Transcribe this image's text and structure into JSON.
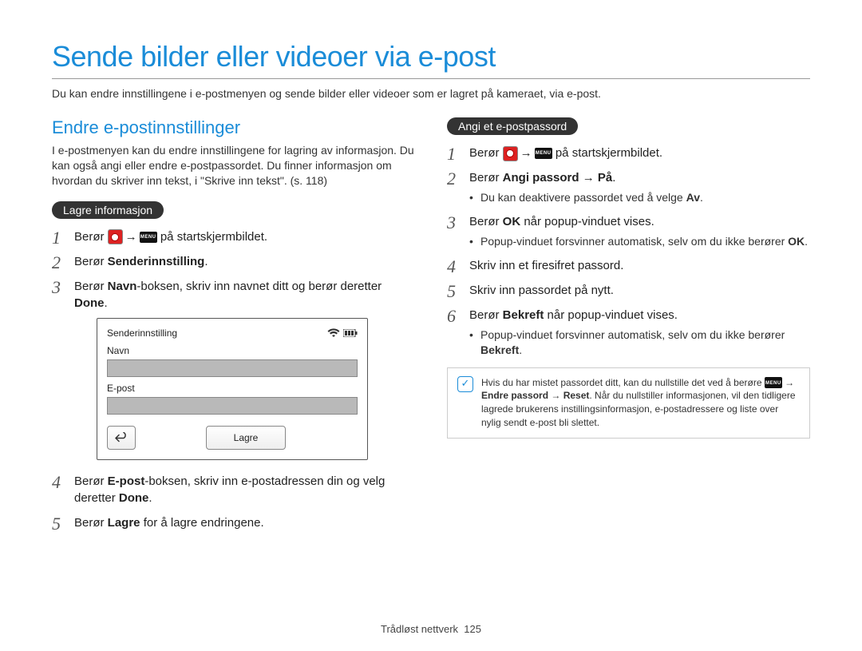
{
  "page": {
    "title": "Sende bilder eller videoer via e-post",
    "intro": "Du kan endre innstillingene i e-postmenyen og sende bilder eller videoer som er lagret på kameraet, via e-post."
  },
  "left": {
    "section_title": "Endre e-postinnstillinger",
    "section_desc": "I e-postmenyen kan du endre innstillingene for lagring av informasjon. Du kan også angi eller endre e-postpassordet. Du finner informasjon om hvordan du skriver inn tekst, i \"Skrive inn tekst\". (s. 118)",
    "pill": "Lagre informasjon",
    "step1_prefix": "Berør ",
    "step1_suffix": " på startskjermbildet.",
    "step2_prefix": "Berør ",
    "step2_bold": "Senderinnstilling",
    "step2_suffix": ".",
    "step3_prefix": "Berør ",
    "step3_bold": "Navn",
    "step3_mid": "-boksen, skriv inn navnet ditt og berør deretter ",
    "step3_bold2": "Done",
    "step3_suffix": ".",
    "step4_prefix": "Berør ",
    "step4_bold": "E-post",
    "step4_mid": "-boksen, skriv inn e-postadressen din og velg deretter ",
    "step4_bold2": "Done",
    "step4_suffix": ".",
    "step5_prefix": "Berør ",
    "step5_bold": "Lagre",
    "step5_suffix": " for å lagre endringene.",
    "illustration": {
      "title": "Senderinnstilling",
      "label_name": "Navn",
      "label_email": "E-post",
      "save_button": "Lagre"
    }
  },
  "right": {
    "pill": "Angi et e-postpassord",
    "step1_prefix": "Berør ",
    "step1_suffix": " på startskjermbildet.",
    "step2_prefix": "Berør ",
    "step2_bold": "Angi passord",
    "step2_arrow": " → ",
    "step2_bold2": "På",
    "step2_suffix": ".",
    "step2_bullet_prefix": "Du kan deaktivere passordet ved å velge ",
    "step2_bullet_bold": "Av",
    "step2_bullet_suffix": ".",
    "step3_prefix": "Berør ",
    "step3_bold": "OK",
    "step3_suffix": " når popup-vinduet vises.",
    "step3_bullet_prefix": "Popup-vinduet forsvinner automatisk, selv om du ikke berører ",
    "step3_bullet_bold": "OK",
    "step3_bullet_suffix": ".",
    "step4": "Skriv inn et firesifret passord.",
    "step5": "Skriv inn passordet på nytt.",
    "step6_prefix": "Berør ",
    "step6_bold": "Bekreft",
    "step6_suffix": " når popup-vinduet vises.",
    "step6_bullet_prefix": "Popup-vinduet forsvinner automatisk, selv om du ikke berører ",
    "step6_bullet_bold": "Bekreft",
    "step6_bullet_suffix": ".",
    "note_prefix": "Hvis du har mistet passordet ditt, kan du nullstille det ved å berøre ",
    "note_arrow": " → ",
    "note_bold1": "Endre passord",
    "note_arrow2": " → ",
    "note_bold2": "Reset",
    "note_suffix": ". Når du nullstiller informasjonen, vil den tidligere lagrede brukerens instillingsinformasjon, e-postadressere og liste over nylig sendt e-post bli slettet.",
    "menu_label": "MENU"
  },
  "footer": {
    "section": "Trådløst nettverk",
    "page_num": "125"
  }
}
